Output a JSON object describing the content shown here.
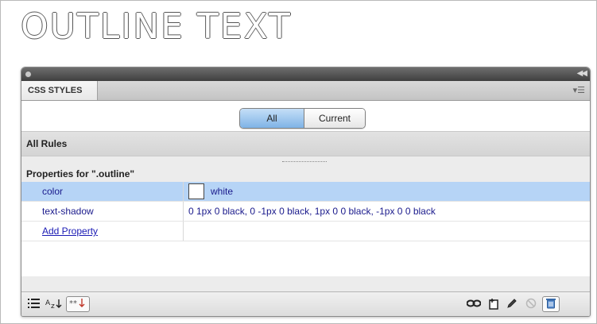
{
  "preview": {
    "title": "OUTLINE TEXT"
  },
  "panel": {
    "tab_label": "CSS STYLES",
    "menu_icon": "panel-menu-icon",
    "toggle": {
      "all_label": "All",
      "current_label": "Current",
      "selected": "All"
    },
    "rules_header": "All Rules",
    "properties_header": "Properties for \".outline\"",
    "properties": [
      {
        "name": "color",
        "value": "white",
        "swatch": "#ffffff",
        "selected": true
      },
      {
        "name": "text-shadow",
        "value": "0 1px 0 black, 0 -1px 0 black, 1px 0 0 black, -1px 0 0 black",
        "selected": false
      }
    ],
    "add_property_label": "Add Property",
    "footer_icons": {
      "left": [
        "category-view-icon",
        "alphabetical-view-icon",
        "set-properties-only-icon"
      ],
      "right": [
        "attach-stylesheet-icon",
        "new-rule-icon",
        "edit-rule-icon",
        "disable-property-icon",
        "delete-icon"
      ]
    }
  }
}
